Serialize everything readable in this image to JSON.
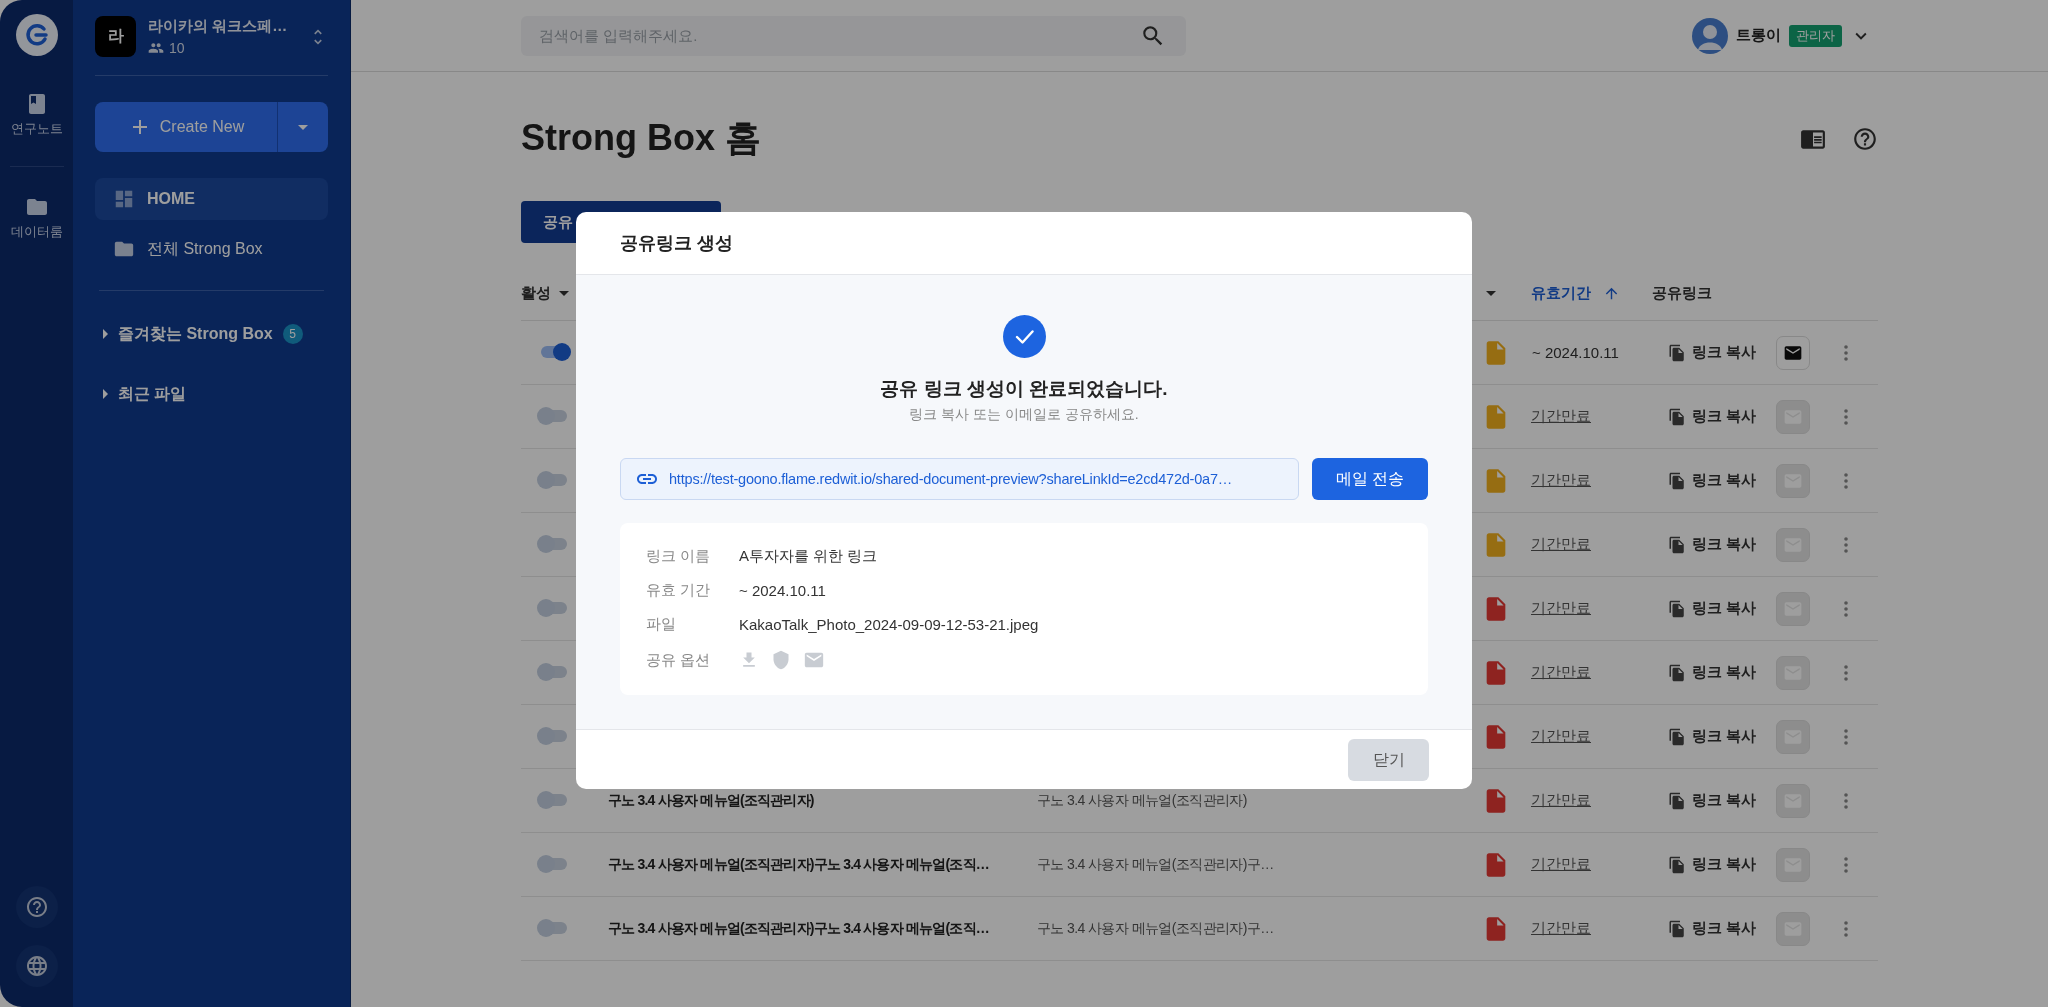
{
  "rail": {
    "items": [
      {
        "label": "연구노트",
        "kind": "notebook"
      },
      {
        "label": "데이터룸",
        "kind": "folder"
      }
    ]
  },
  "workspace": {
    "avatar": "라",
    "name": "라이카의 워크스페…",
    "members": "10"
  },
  "create_button": {
    "label": "Create New"
  },
  "nav": [
    {
      "label": "HOME",
      "kind": "home",
      "selected": true
    },
    {
      "label": "전체 Strong Box",
      "kind": "box",
      "selected": false
    }
  ],
  "sections": [
    {
      "label": "즐겨찾는 Strong Box",
      "badge": "5"
    },
    {
      "label": "최근 파일"
    }
  ],
  "search": {
    "placeholder": "검색어를 입력해주세요."
  },
  "user": {
    "name": "트롱이",
    "role": "관리자"
  },
  "page": {
    "title": "Strong Box 홈",
    "tab_button": "공유"
  },
  "table": {
    "header": {
      "active": "활성",
      "expiry": "유효기간",
      "link": "공유링크"
    },
    "rows": [
      {
        "on": true,
        "kind": "image",
        "expiry": "~ 2024.10.11",
        "expired": false,
        "link": "링크 복사",
        "mail_enabled": true
      },
      {
        "on": false,
        "kind": "image",
        "expiry": "기간만료",
        "expired": true,
        "link": "링크 복사",
        "mail_enabled": false
      },
      {
        "on": false,
        "kind": "image",
        "expiry": "기간만료",
        "expired": true,
        "link": "링크 복사",
        "mail_enabled": false
      },
      {
        "on": false,
        "kind": "image",
        "expiry": "기간만료",
        "expired": true,
        "link": "링크 복사",
        "mail_enabled": false
      },
      {
        "on": false,
        "kind": "pdf",
        "expiry": "기간만료",
        "expired": true,
        "link": "링크 복사",
        "mail_enabled": false
      },
      {
        "on": false,
        "kind": "pdf",
        "expiry": "기간만료",
        "expired": true,
        "link": "링크 복사",
        "mail_enabled": false
      },
      {
        "on": false,
        "kind": "pdf",
        "expiry": "기간만료",
        "expired": true,
        "link": "링크 복사",
        "mail_enabled": false
      },
      {
        "on": false,
        "name": "구노 3.4 사용자 메뉴얼(조직관리자)",
        "description": "구노 3.4 사용자 메뉴얼(조직관리자)",
        "kind": "pdf",
        "expiry": "기간만료",
        "expired": true,
        "link": "링크 복사",
        "mail_enabled": false
      },
      {
        "on": false,
        "name": "구노 3.4 사용자 메뉴얼(조직관리자)구노 3.4 사용자 메뉴얼(조직…",
        "description": "구노 3.4 사용자 메뉴얼(조직관리자)구…",
        "kind": "pdf",
        "expiry": "기간만료",
        "expired": true,
        "link": "링크 복사",
        "mail_enabled": false
      },
      {
        "on": false,
        "name": "구노 3.4 사용자 메뉴얼(조직관리자)구노 3.4 사용자 메뉴얼(조직…",
        "description": "구노 3.4 사용자 메뉴얼(조직관리자)구…",
        "kind": "pdf",
        "expiry": "기간만료",
        "expired": true,
        "link": "링크 복사",
        "mail_enabled": false
      }
    ]
  },
  "modal": {
    "title": "공유링크 생성",
    "heading": "공유 링크 생성이 완료되었습니다.",
    "subtext": "링크 복사 또는 이메일로 공유하세요.",
    "url": "https://test-goono.flame.redwit.io/shared-document-preview?shareLinkId=e2cd472d-0a7…",
    "send_button": "메일 전송",
    "details": [
      {
        "label": "링크 이름",
        "value": "A투자자를 위한 링크"
      },
      {
        "label": "유효 기간",
        "value": "~ 2024.10.11"
      },
      {
        "label": "파일",
        "value": "KakaoTalk_Photo_2024-09-09-12-53-21.jpeg"
      },
      {
        "label": "공유 옵션",
        "options": [
          {
            "kind": "download",
            "enabled": false
          },
          {
            "kind": "security",
            "enabled": false
          },
          {
            "kind": "mail",
            "enabled": false
          }
        ]
      }
    ],
    "close_button": "닫기"
  }
}
